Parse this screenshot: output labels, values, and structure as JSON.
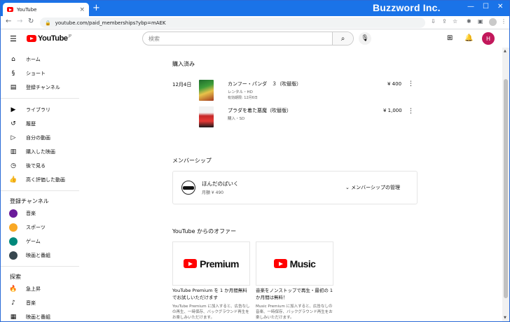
{
  "browser": {
    "tab_title": "YouTube",
    "tab_close": "×",
    "new_tab": "+",
    "url": "youtube.com/paid_memberships?ybp=mAEK",
    "watermark": "Buzzword Inc."
  },
  "header": {
    "logo_text": "YouTube",
    "logo_sub": "JP",
    "search_placeholder": "検索",
    "avatar_letter": "H"
  },
  "sidebar": {
    "main": [
      {
        "label": "ホーム",
        "icon": "home-icon"
      },
      {
        "label": "ショート",
        "icon": "shorts-icon"
      },
      {
        "label": "登録チャンネル",
        "icon": "subscriptions-icon"
      }
    ],
    "library": [
      {
        "label": "ライブラリ",
        "icon": "library-icon"
      },
      {
        "label": "履歴",
        "icon": "history-icon"
      },
      {
        "label": "自分の動画",
        "icon": "my-videos-icon"
      },
      {
        "label": "購入した映画",
        "icon": "purchases-icon"
      },
      {
        "label": "後で見る",
        "icon": "watch-later-icon"
      },
      {
        "label": "高く評価した動画",
        "icon": "liked-icon"
      }
    ],
    "subs_heading": "登録チャンネル",
    "subs": [
      {
        "label": "音楽",
        "color": "#6a1b9a"
      },
      {
        "label": "スポーツ",
        "color": "#f9a825"
      },
      {
        "label": "ゲーム",
        "color": "#00897b"
      },
      {
        "label": "映画と番組",
        "color": "#37474f"
      }
    ],
    "explore_heading": "探索",
    "explore": [
      {
        "label": "急上昇",
        "icon": "trending-icon"
      },
      {
        "label": "音楽",
        "icon": "music-icon"
      },
      {
        "label": "映画と番組",
        "icon": "movies-icon"
      }
    ]
  },
  "purchases": {
    "heading": "購入済み",
    "date": "12月4日",
    "items": [
      {
        "title": "カンフー・パンダ　３（吹替版）",
        "line1": "レンタル・HD",
        "line2": "有効期限: 12月6日",
        "price": "¥ 400"
      },
      {
        "title": "プラダを着た悪魔（吹替版）",
        "line1": "購入・SD",
        "line2": "",
        "price": "¥ 1,000"
      }
    ]
  },
  "membership": {
    "heading": "メンバーシップ",
    "channel": "ほんだのばいく",
    "fee": "月額 ¥ 490",
    "manage": "メンバーシップの管理"
  },
  "offers": {
    "heading": "YouTube からのオファー",
    "items": [
      {
        "logo": "Premium",
        "title": "YouTube Premium を 1 か月間無料でお試しいただけます",
        "desc": "YouTube Premium に加入すると、広告なしの再生、一時保存、バックグラウンド再生をお楽しみいただけます。"
      },
      {
        "logo": "Music",
        "title": "音楽をノンストップで再生・最初の 1 か月間は無料！",
        "desc": "Music Premium に加入すると、広告なしの音楽、一時保存、バックグラウンド再生をお楽しみいただけます。"
      }
    ]
  }
}
